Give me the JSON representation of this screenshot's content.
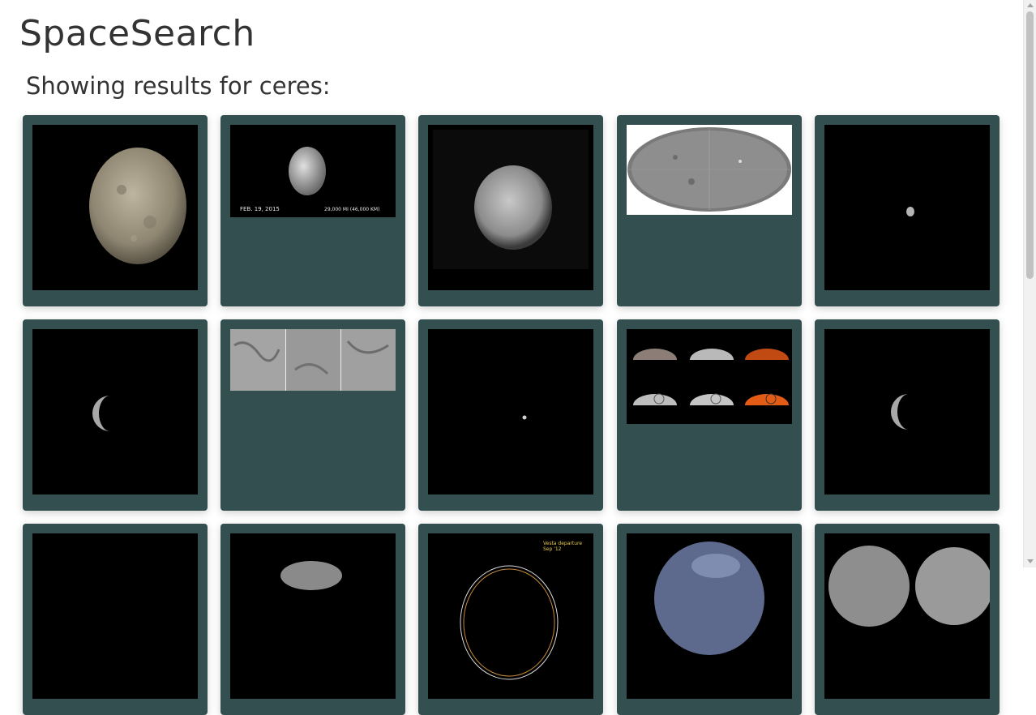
{
  "header": {
    "site_title": "SpaceSearch",
    "results_heading": "Showing results for ceres:"
  },
  "colors": {
    "card_background": "#334f4f",
    "page_background": "#ffffff",
    "text": "#333333"
  },
  "results": [
    {
      "image": "ceres-full-disk-color-image"
    },
    {
      "image": "ceres-approach-image-feb-19-2015",
      "caption_left": "FEB. 19, 2015",
      "caption_right": "29,000 MI   (46,000 KM)"
    },
    {
      "image": "ceres-blurry-gray-disk-image"
    },
    {
      "image": "ceres-global-map-projection-image"
    },
    {
      "image": "ceres-distant-dot-image"
    },
    {
      "image": "ceres-crescent-image"
    },
    {
      "image": "ceres-surface-closeup-triptych-image"
    },
    {
      "image": "ceres-tiny-dot-image"
    },
    {
      "image": "ceres-bright-spots-comparison-image"
    },
    {
      "image": "ceres-crescent-image-2"
    },
    {
      "image": "ceres-dark-image"
    },
    {
      "image": "ceres-partial-disk-image"
    },
    {
      "image": "vesta-departure-orbit-diagram-image",
      "caption_line1": "Vesta departure",
      "caption_line2": "Sep '12"
    },
    {
      "image": "ceres-blue-tinted-disk-image"
    },
    {
      "image": "ceres-pair-gray-disks-image"
    }
  ]
}
